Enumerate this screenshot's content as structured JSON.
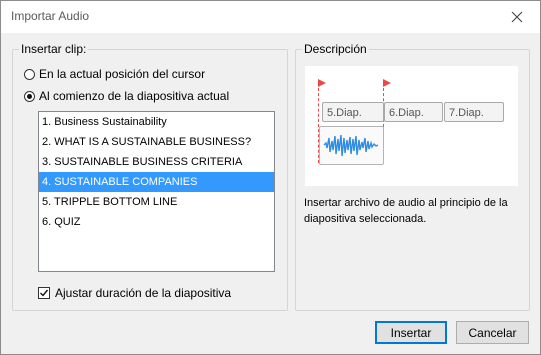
{
  "window": {
    "title": "Importar Audio"
  },
  "insert_group": {
    "legend": "Insertar clip:",
    "option_cursor": "En la actual posición del cursor",
    "option_slide_start": "Al comienzo de la diapositiva actual",
    "selected_option": "slide_start",
    "slides": [
      "1. Business Sustainability",
      "2. WHAT IS A SUSTAINABLE BUSINESS?",
      "3. SUSTAINABLE BUSINESS CRITERIA",
      "4. SUSTAINABLE COMPANIES",
      "5. TRIPPLE BOTTOM LINE",
      "6. QUIZ"
    ],
    "selected_slide_index": 3,
    "adjust_duration_label": "Ajustar duración de la diapositiva",
    "adjust_duration_checked": true
  },
  "description_group": {
    "legend": "Descripción",
    "slots": [
      "5.Diap.",
      "6.Diap.",
      "7.Diap."
    ],
    "text": "Insertar archivo de audio al principio de la diapositiva seleccionada."
  },
  "buttons": {
    "insert": "Insertar",
    "cancel": "Cancelar"
  },
  "colors": {
    "selection": "#3399ff",
    "marker": "#e84a4a",
    "wave": "#2f8de4"
  },
  "icons": [
    "close-icon",
    "flag-icon",
    "waveform-icon",
    "checkmark-icon"
  ]
}
